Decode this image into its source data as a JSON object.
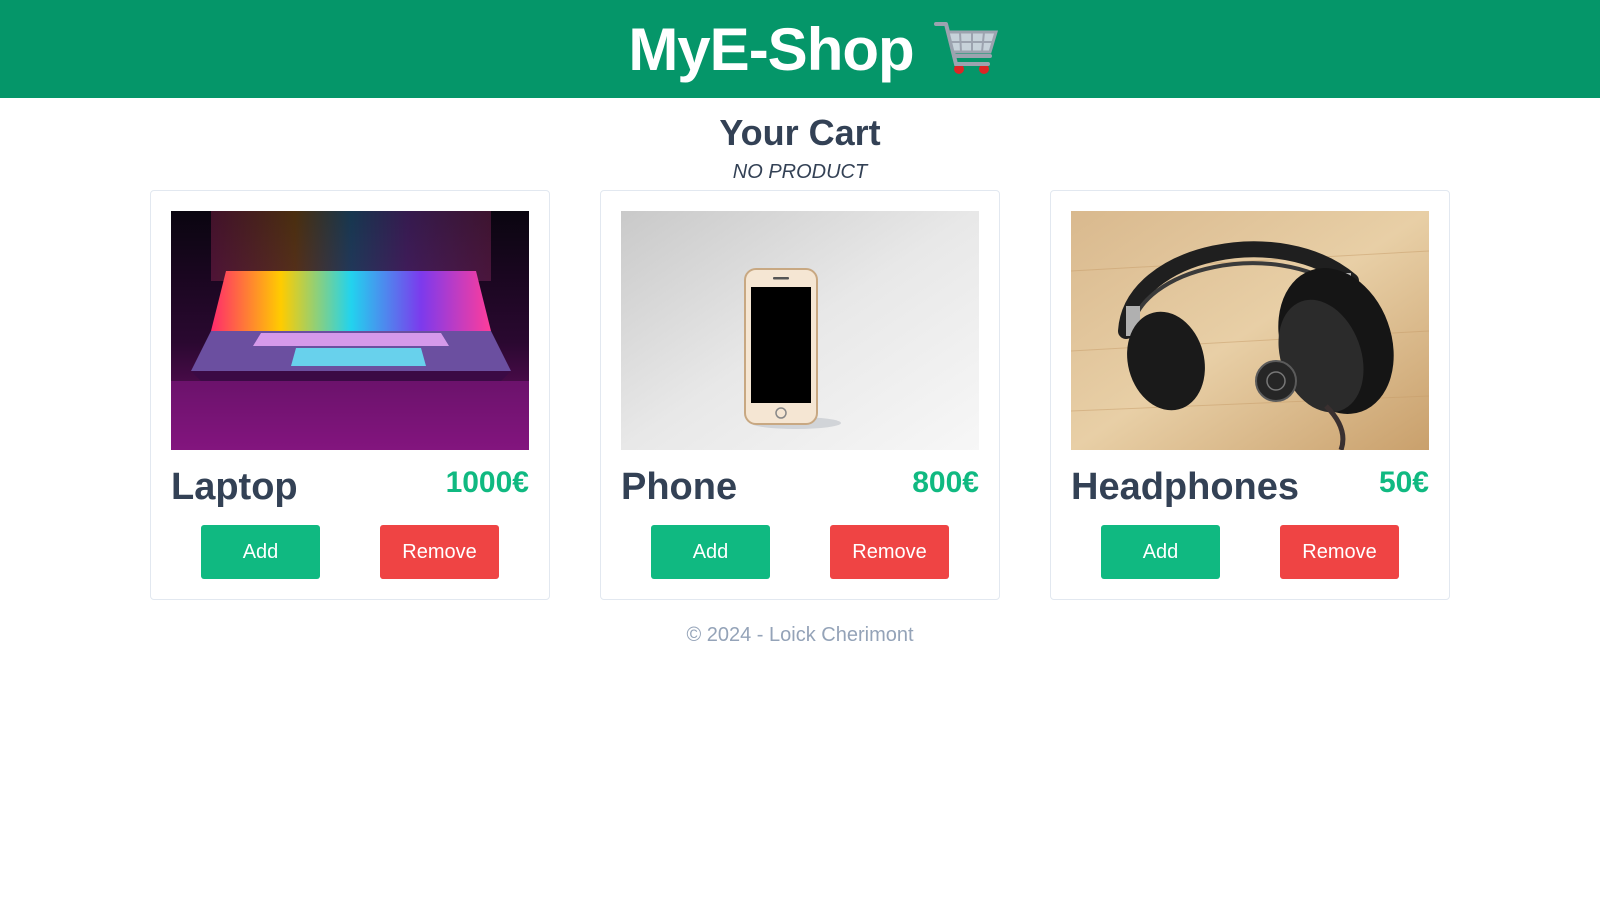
{
  "header": {
    "brand": "MyE-Shop",
    "icon": "shopping-cart-icon",
    "color": "#059669"
  },
  "cart": {
    "title": "Your Cart",
    "status": "NO PRODUCT"
  },
  "products": [
    {
      "name": "Laptop",
      "price": "1000€",
      "add_label": "Add",
      "remove_label": "Remove",
      "image": "laptop-image"
    },
    {
      "name": "Phone",
      "price": "800€",
      "add_label": "Add",
      "remove_label": "Remove",
      "image": "phone-image"
    },
    {
      "name": "Headphones",
      "price": "50€",
      "add_label": "Add",
      "remove_label": "Remove",
      "image": "headphones-image"
    }
  ],
  "footer": {
    "text": "© 2024 - Loick Cherimont"
  },
  "colors": {
    "accent": "#10b981",
    "danger": "#ef4444",
    "text": "#334155",
    "muted": "#94a3b8"
  }
}
